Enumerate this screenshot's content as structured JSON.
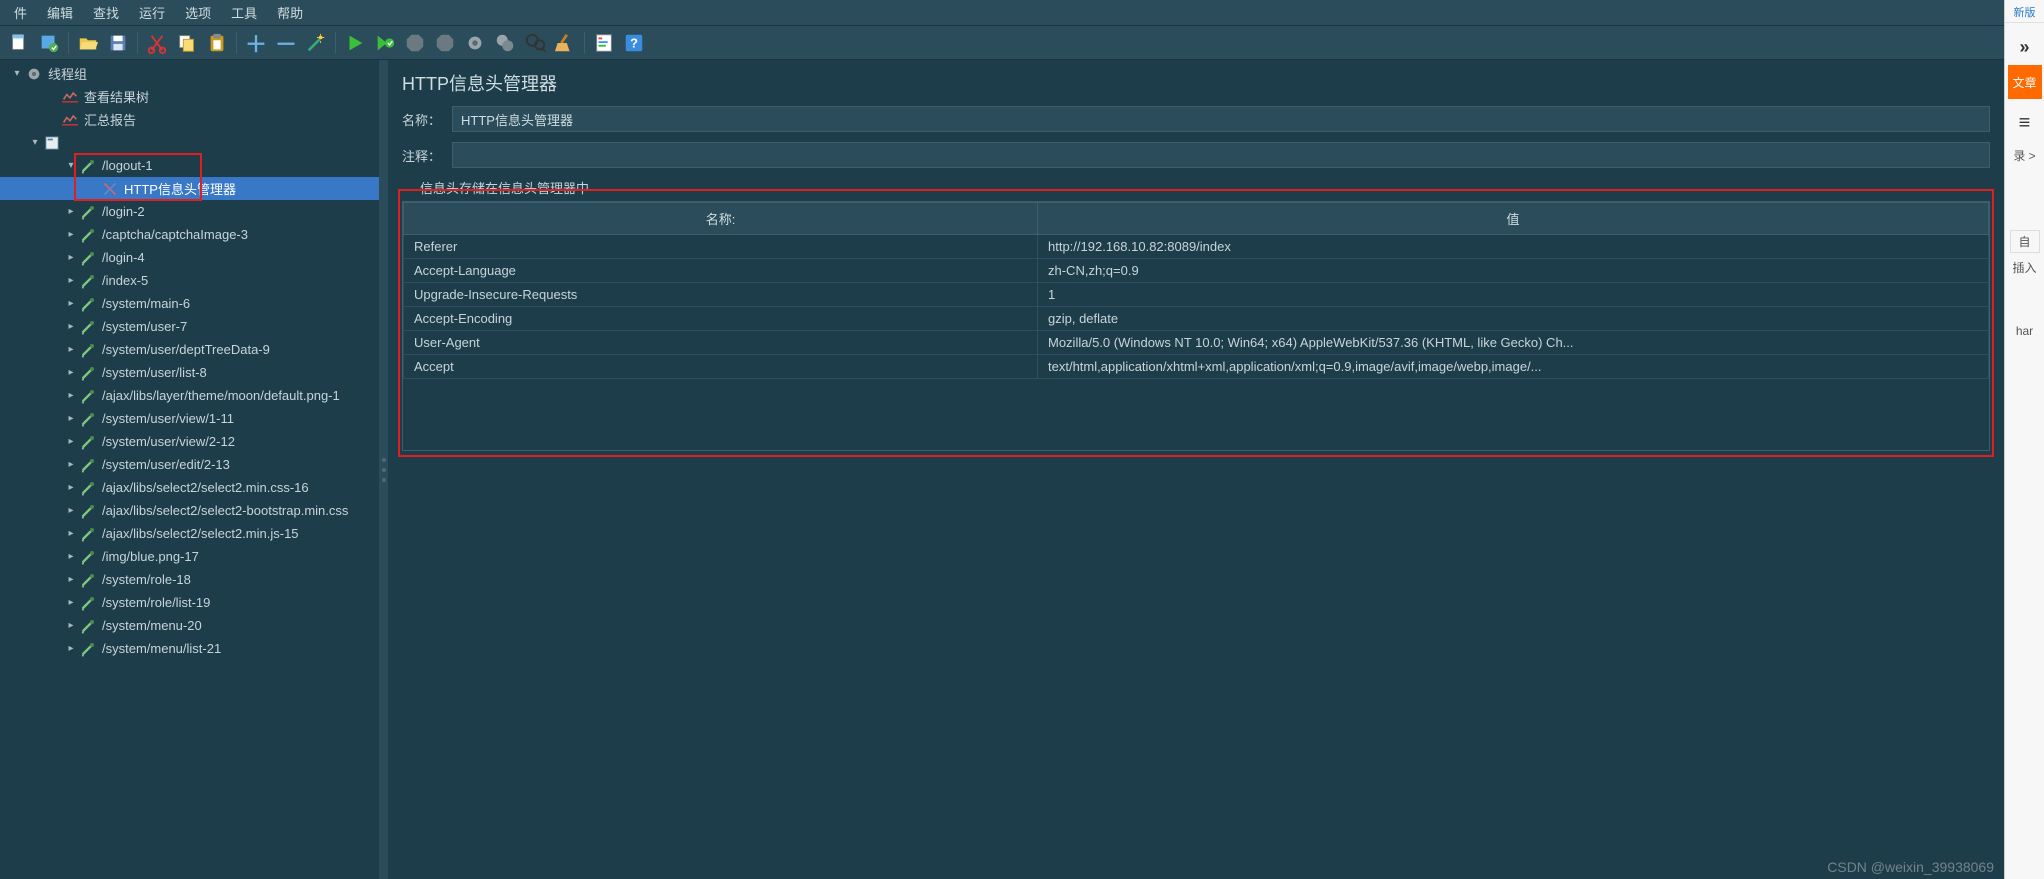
{
  "menubar": {
    "items": [
      "件",
      "编辑",
      "查找",
      "运行",
      "选项",
      "工具",
      "帮助"
    ]
  },
  "toolbar": {
    "btn_new": "📄",
    "btn_tpl": "📑",
    "btn_open": "📂",
    "btn_save": "💾",
    "btn_cut": "✂",
    "btn_copy": "📋",
    "btn_paste": "📋",
    "btn_add": "＋",
    "btn_remove": "－",
    "btn_wand": "🪄",
    "btn_run": "▶",
    "btn_run_no_pause": "▶",
    "btn_stop": "⏹",
    "btn_shutdown": "⏹",
    "btn_clear": "⚙",
    "btn_clear_all": "⚙",
    "btn_search": "🔍",
    "btn_func": "🧹",
    "btn_report": "📊",
    "btn_help": "❓"
  },
  "sidebar": {
    "root": "线程组",
    "view_results": "查看结果树",
    "summary_report": "汇总报告",
    "items": [
      {
        "label": "/logout-1",
        "expanded": true
      },
      {
        "label": "HTTP信息头管理器",
        "child": true,
        "selected": true
      },
      {
        "label": "/login-2"
      },
      {
        "label": "/captcha/captchaImage-3"
      },
      {
        "label": "/login-4"
      },
      {
        "label": "/index-5"
      },
      {
        "label": "/system/main-6"
      },
      {
        "label": "/system/user-7"
      },
      {
        "label": "/system/user/deptTreeData-9"
      },
      {
        "label": "/system/user/list-8"
      },
      {
        "label": "/ajax/libs/layer/theme/moon/default.png-1"
      },
      {
        "label": "/system/user/view/1-11"
      },
      {
        "label": "/system/user/view/2-12"
      },
      {
        "label": "/system/user/edit/2-13"
      },
      {
        "label": "/ajax/libs/select2/select2.min.css-16"
      },
      {
        "label": "/ajax/libs/select2/select2-bootstrap.min.css"
      },
      {
        "label": "/ajax/libs/select2/select2.min.js-15"
      },
      {
        "label": "/img/blue.png-17"
      },
      {
        "label": "/system/role-18"
      },
      {
        "label": "/system/role/list-19"
      },
      {
        "label": "/system/menu-20"
      },
      {
        "label": "/system/menu/list-21"
      }
    ]
  },
  "panel": {
    "title": "HTTP信息头管理器",
    "name_label": "名称：",
    "name_value": "HTTP信息头管理器",
    "comment_label": "注释：",
    "comment_value": "",
    "section_label": "信息头存储在信息头管理器中",
    "table": {
      "col_name": "名称:",
      "col_value": "值",
      "rows": [
        {
          "name": "Referer",
          "value": "http://192.168.10.82:8089/index"
        },
        {
          "name": "Accept-Language",
          "value": "zh-CN,zh;q=0.9"
        },
        {
          "name": "Upgrade-Insecure-Requests",
          "value": "1"
        },
        {
          "name": "Accept-Encoding",
          "value": "gzip, deflate"
        },
        {
          "name": "User-Agent",
          "value": "Mozilla/5.0 (Windows NT 10.0; Win64; x64) AppleWebKit/537.36 (KHTML, like Gecko) Ch..."
        },
        {
          "name": "Accept",
          "value": "text/html,application/xhtml+xml,application/xml;q=0.9,image/avif,image/webp,image/..."
        }
      ]
    }
  },
  "watermark": "CSDN @weixin_39938069",
  "right_strip": {
    "top": "新版",
    "more": "»",
    "orange": "文章",
    "hamburger": "≡",
    "login": "录 >",
    "custom": "自",
    "insert": "插入",
    "har": "har"
  }
}
